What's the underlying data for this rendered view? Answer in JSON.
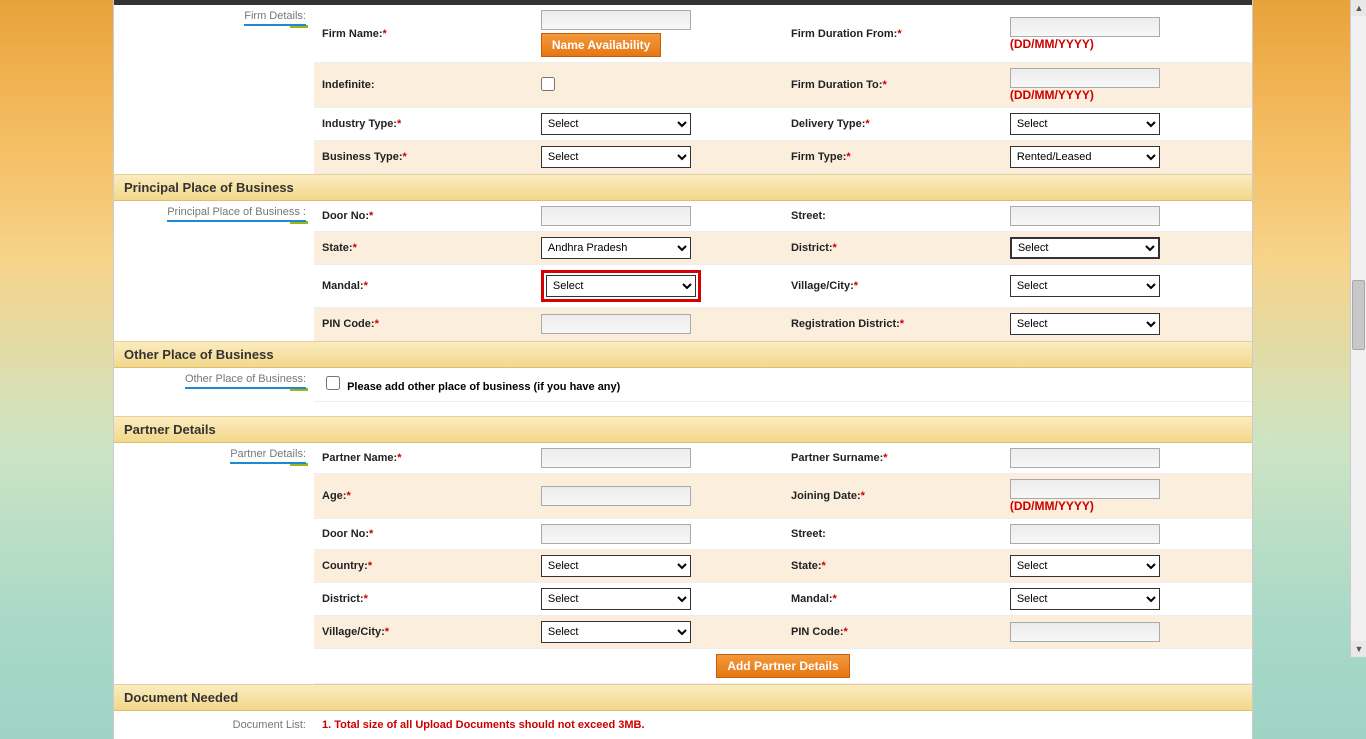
{
  "firm": {
    "name_label": "Firm Name:",
    "name_avail_btn": "Name Availability",
    "indefinite_label": "Indefinite:",
    "industry_label": "Industry Type:",
    "industry_val": "Select",
    "business_label": "Business Type:",
    "business_val": "Select",
    "duration_from_label": "Firm Duration From:",
    "duration_to_label": "Firm Duration To:",
    "date_hint": "(DD/MM/YYYY)",
    "delivery_label": "Delivery Type:",
    "delivery_val": "Select",
    "firm_type_label": "Firm Type:",
    "firm_type_val": "Rented/Leased",
    "side_label": "Firm Details:"
  },
  "ppob": {
    "header": "Principal Place of Business",
    "side_label": "Principal Place of Business :",
    "door_label": "Door No:",
    "street_label": "Street:",
    "state_label": "State:",
    "state_val": "Andhra Pradesh",
    "district_label": "District:",
    "district_val": "Select",
    "mandal_label": "Mandal:",
    "mandal_val": "Select",
    "village_label": "Village/City:",
    "village_val": "Select",
    "pin_label": "PIN Code:",
    "regdist_label": "Registration District:",
    "regdist_val": "Select"
  },
  "opob": {
    "header": "Other Place of Business",
    "side_label": "Other Place of Business:",
    "check_label": "Please add other place of business (if you have any)"
  },
  "partner": {
    "header": "Partner Details",
    "side_label": "Partner Details:",
    "name_label": "Partner Name:",
    "surname_label": "Partner Surname:",
    "age_label": "Age:",
    "joining_label": "Joining Date:",
    "date_hint": "(DD/MM/YYYY)",
    "door_label": "Door No:",
    "street_label": "Street:",
    "country_label": "Country:",
    "country_val": "Select",
    "state_label": "State:",
    "state_val": "Select",
    "district_label": "District:",
    "district_val": "Select",
    "mandal_label": "Mandal:",
    "mandal_val": "Select",
    "village_label": "Village/City:",
    "village_val": "Select",
    "pin_label": "PIN Code:",
    "add_btn": "Add Partner Details"
  },
  "doc": {
    "header": "Document Needed",
    "side_label": "Document List:",
    "msg1": "1. Total size of all Upload Documents should not exceed 3MB."
  }
}
